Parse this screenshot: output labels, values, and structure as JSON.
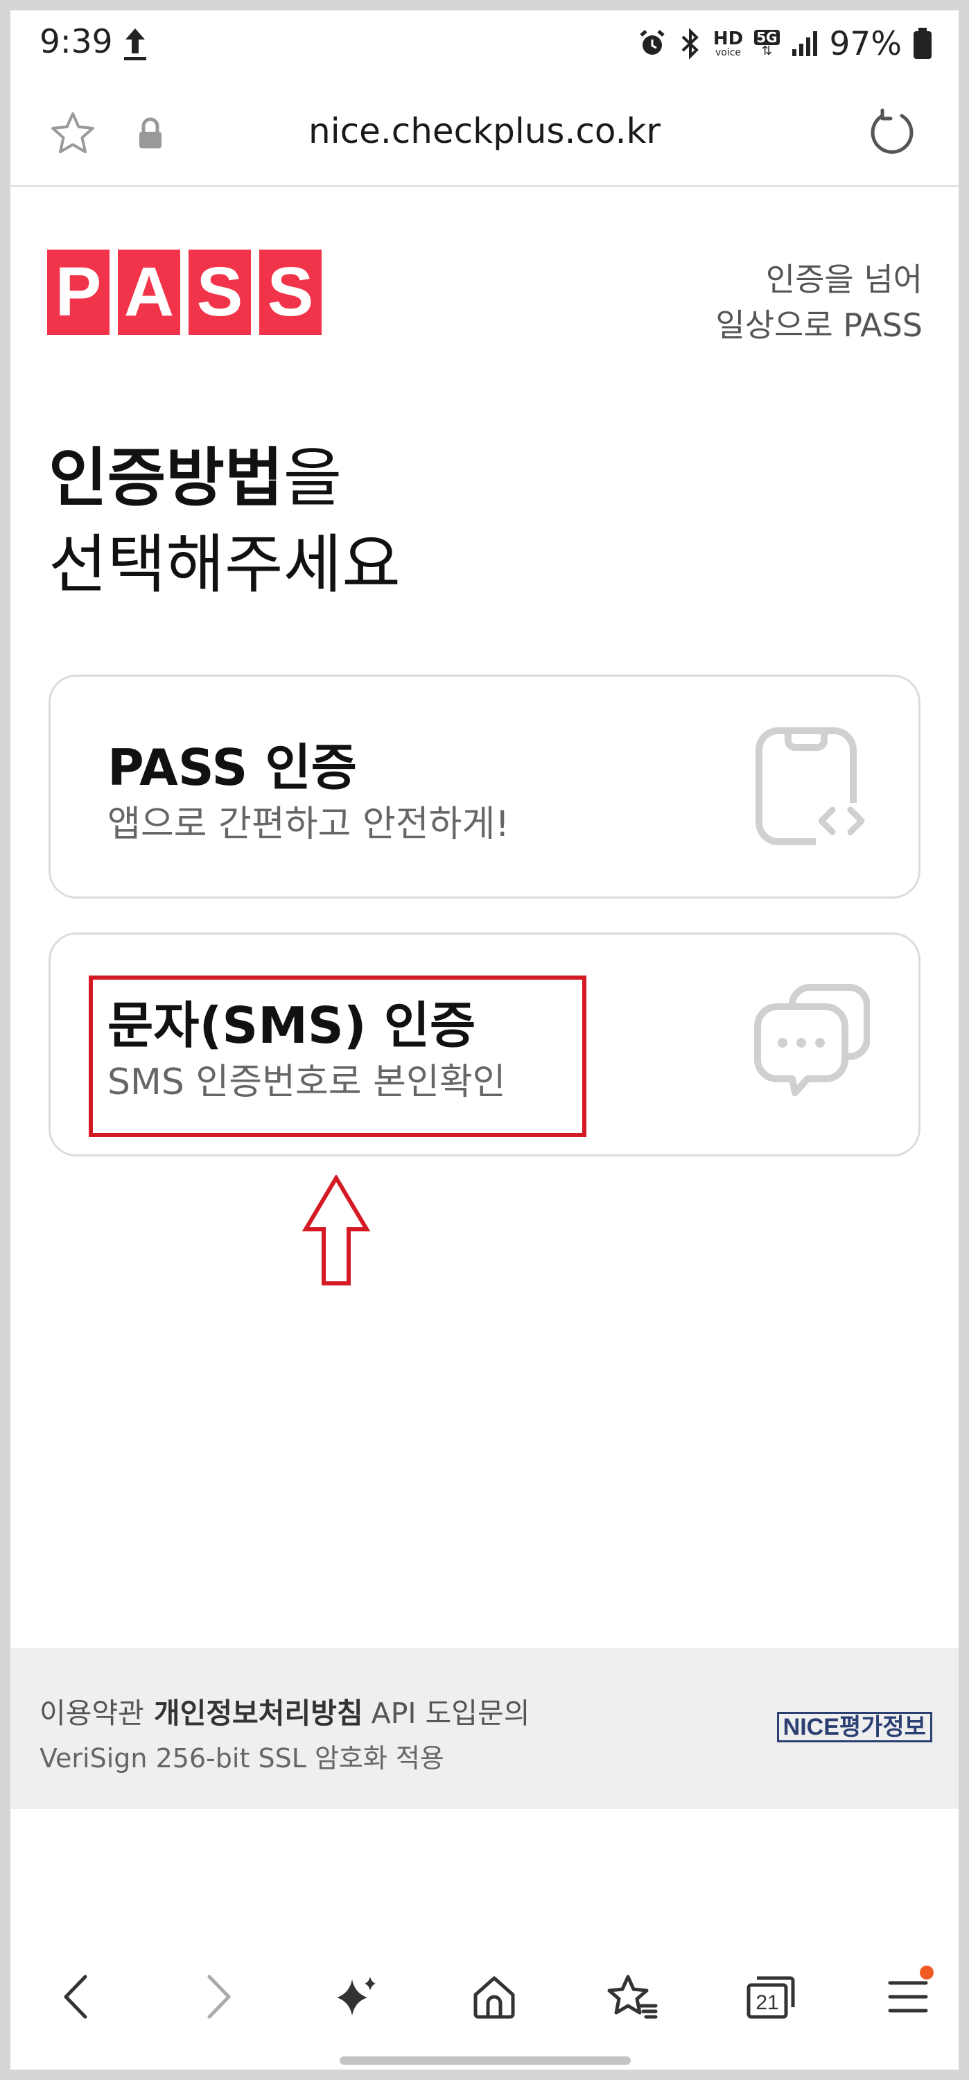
{
  "status_bar": {
    "time": "9:39",
    "network": "5G",
    "hd_label": "HD",
    "hd_sub": "voice",
    "battery": "97%"
  },
  "browser": {
    "url": "nice.checkplus.co.kr",
    "tabs_count": "21"
  },
  "page": {
    "logo_letters": [
      "P",
      "A",
      "S",
      "S"
    ],
    "tagline_line1": "인증을 넘어",
    "tagline_line2": "일상으로 PASS",
    "headline_bold": "인증방법",
    "headline_rest": "을",
    "headline_line2": "선택해주세요",
    "options": [
      {
        "title": "PASS 인증",
        "subtitle": "앱으로 간편하고 안전하게!"
      },
      {
        "title": "문자(SMS) 인증",
        "subtitle": "SMS 인증번호로 본인확인"
      }
    ]
  },
  "footer": {
    "terms": "이용약관",
    "privacy": "개인정보처리방침",
    "api": "API 도입문의",
    "ssl": "VeriSign 256-bit SSL 암호화 적용",
    "brand": "NICE평가정보"
  },
  "colors": {
    "brand_red": "#f2344a",
    "annotation_red": "#d31a25",
    "nav_badge": "#f05a23"
  }
}
